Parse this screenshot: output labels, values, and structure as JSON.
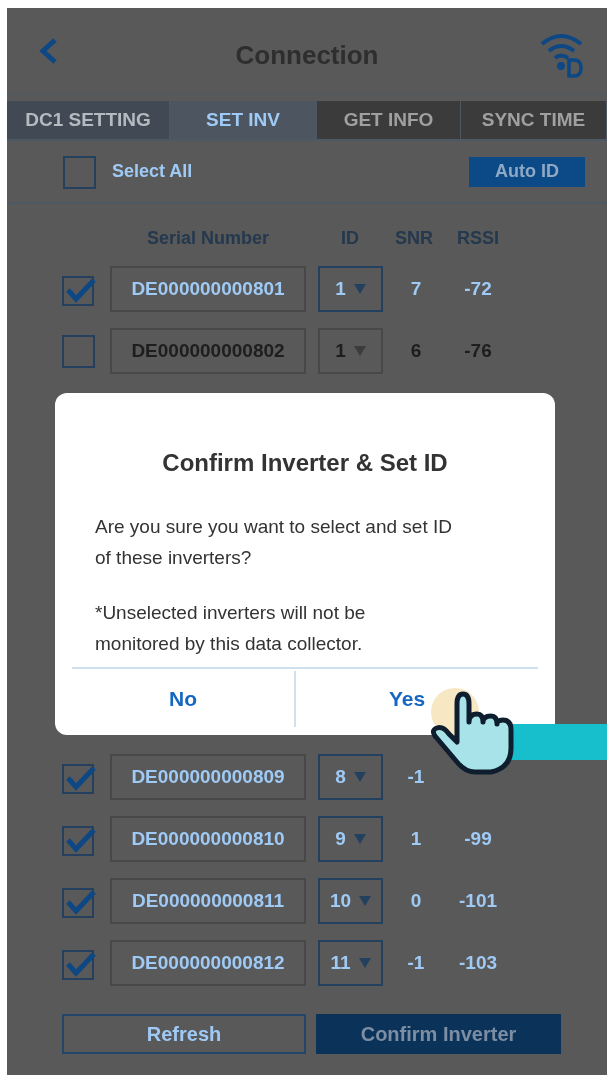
{
  "header": {
    "title": "Connection"
  },
  "tabs": [
    {
      "label": "DC1 SETTING",
      "selected": false,
      "disabled": false
    },
    {
      "label": "SET INV",
      "selected": true,
      "disabled": false
    },
    {
      "label": "GET INFO",
      "selected": false,
      "disabled": true
    },
    {
      "label": "SYNC TIME",
      "selected": false,
      "disabled": true
    }
  ],
  "select_all": {
    "label": "Select All",
    "checked": false
  },
  "auto_id_button": "Auto ID",
  "table": {
    "columns": [
      "Serial Number",
      "ID",
      "SNR",
      "RSSI"
    ],
    "rows_top": [
      {
        "checked": true,
        "serial": "DE000000000801",
        "id": "1",
        "snr": "7",
        "rssi": "-72"
      },
      {
        "checked": false,
        "serial": "DE000000000802",
        "id": "1",
        "snr": "6",
        "rssi": "-76"
      }
    ],
    "rows_bottom": [
      {
        "checked": true,
        "serial": "DE000000000809",
        "id": "8",
        "snr": "-1"
      },
      {
        "checked": true,
        "serial": "DE000000000810",
        "id": "9",
        "snr": "1",
        "rssi": "-99"
      },
      {
        "checked": true,
        "serial": "DE000000000811",
        "id": "10",
        "snr": "0",
        "rssi": "-101"
      },
      {
        "checked": true,
        "serial": "DE000000000812",
        "id": "11",
        "snr": "-1",
        "rssi": "-103"
      }
    ]
  },
  "buttons": [
    "Refresh",
    "Confirm Inverter"
  ],
  "dialog": {
    "title": "Confirm Inverter & Set ID",
    "message": "Are you sure you want to select and set ID of these inverters?",
    "note": "*Unselected inverters will not be monitored by this data collector.",
    "buttons": [
      "No",
      "Yes"
    ]
  }
}
